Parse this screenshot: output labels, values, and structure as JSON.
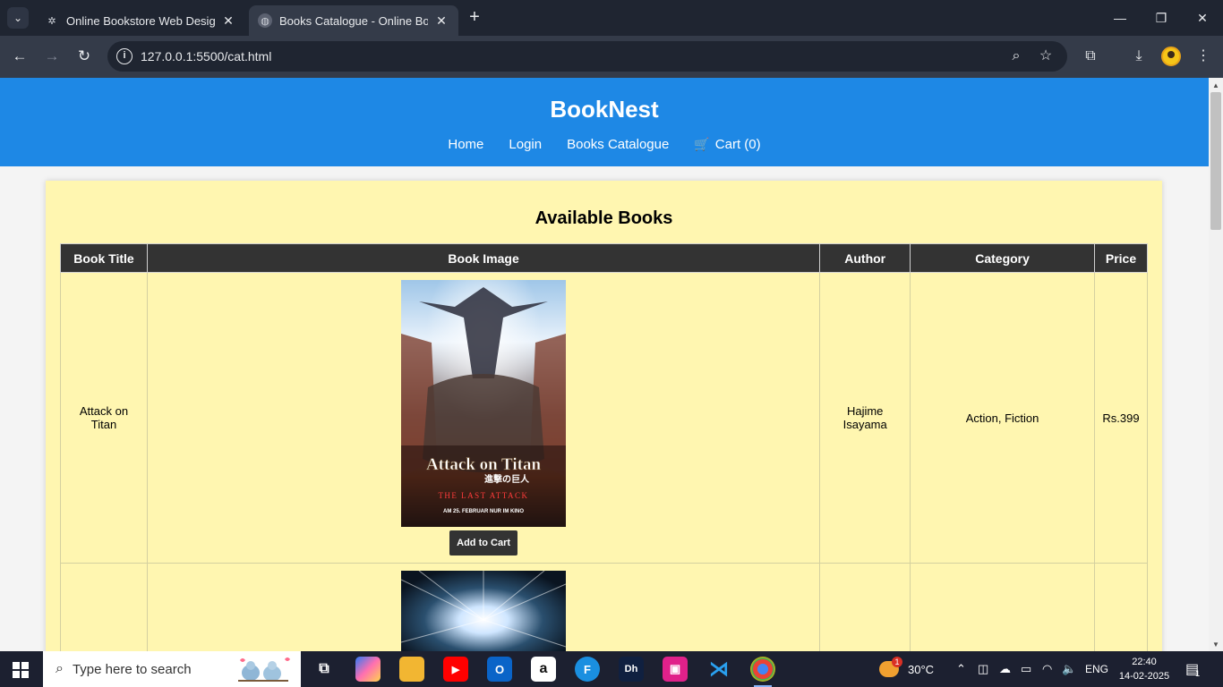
{
  "browser": {
    "tabs": [
      {
        "title": "Online Bookstore Web Design",
        "active": false
      },
      {
        "title": "Books Catalogue - Online Book",
        "active": true
      }
    ],
    "url": "127.0.0.1:5500/cat.html"
  },
  "site": {
    "brand": "BookNest",
    "nav": [
      {
        "label": "Home"
      },
      {
        "label": "Login"
      },
      {
        "label": "Books Catalogue"
      },
      {
        "label": "Cart (0)",
        "icon": "cart-icon"
      }
    ]
  },
  "catalogue": {
    "heading": "Available Books",
    "columns": [
      "Book Title",
      "Book Image",
      "Author",
      "Category",
      "Price"
    ],
    "books": [
      {
        "title": "Attack on Titan",
        "cover_text": [
          "Attack on Titan",
          "進撃の巨人",
          "THE LAST ATTACK",
          "AM 25. FEBRUAR NUR IM KINO"
        ],
        "author": "Hajime Isayama",
        "category": "Action, Fiction",
        "price": "Rs.399",
        "button": "Add to Cart"
      }
    ]
  },
  "taskbar": {
    "search_placeholder": "Type here to search",
    "weather": "30°C",
    "language": "ENG",
    "time": "22:40",
    "date": "14-02-2025",
    "notifications": "1",
    "weather_badge": "1"
  },
  "colors": {
    "header_blue": "#1e88e5",
    "card_bg": "#fff6b0",
    "table_header": "#333333"
  }
}
